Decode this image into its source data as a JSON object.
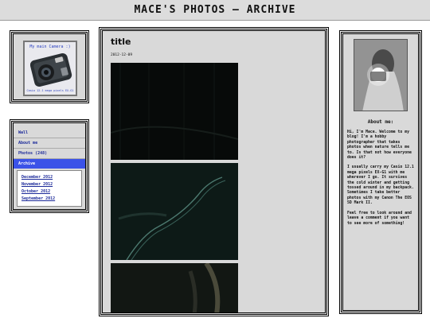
{
  "header": {
    "title": "MACE'S PHOTOS — ARCHIVE"
  },
  "camera_widget": {
    "caption_top": "My main Camera :)",
    "caption_bottom": "Casio 12.1 mega pixels EX-G1"
  },
  "nav": {
    "items": [
      {
        "label": "Wall"
      },
      {
        "label": "About me"
      },
      {
        "label": "Photos (248)"
      },
      {
        "label": "Archive"
      }
    ],
    "archive_months": [
      {
        "label": "December 2012"
      },
      {
        "label": "November 2012"
      },
      {
        "label": "October 2012"
      },
      {
        "label": "September 2012"
      }
    ]
  },
  "post": {
    "title": "title",
    "date": "2012-12-09"
  },
  "about": {
    "heading": "About me:",
    "paragraphs": [
      "Hi, I'm Mace. Welcome to my blog! I'm a hobby photographer that takes photos when nature tells me to. Is that not how everyone does it?",
      "I usually carry my Casio 12.1 mega pixels EX-G1 with me wherever I go. It survives the cold winter and getting tossed around in my backpack. Sometimes I take better photos with my Canon The EOS 5D Mark II.",
      "Feel free to look around and leave a comment if you want to see more of something!"
    ]
  }
}
